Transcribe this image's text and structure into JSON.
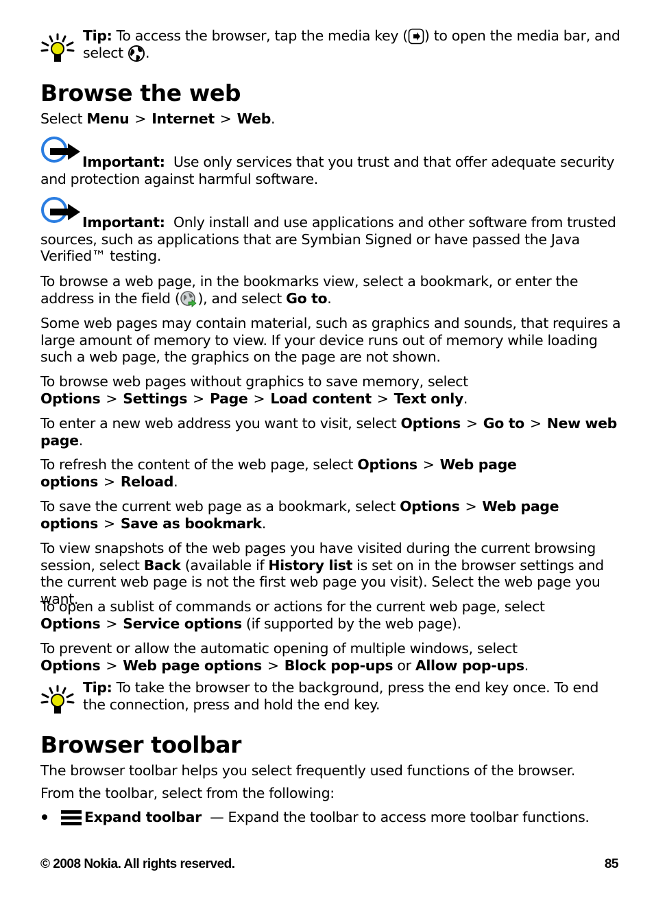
{
  "tip1": {
    "label": "Tip:",
    "text_a": " To access the browser, tap the media key (",
    "text_b": ") to open the media bar, and select ",
    "text_c": ".",
    "icons": [
      "lightbulb-tip-icon",
      "media-key-icon",
      "globe-web-icon"
    ]
  },
  "section1": {
    "title": "Browse the web",
    "path_intro": "Select ",
    "path": [
      "Menu",
      "Internet",
      "Web"
    ],
    "path_end": "."
  },
  "important1": {
    "label": "Important:",
    "text": "Use only services that you trust and that offer adequate security and protection against harmful software."
  },
  "important2": {
    "label": "Important:",
    "text": "Only install and use applications and other software from trusted sources, such as applications that are Symbian Signed or have passed the Java Verified™ testing."
  },
  "paragraphs": {
    "p1_a": "To browse a web page, in the bookmarks view, select a bookmark, or enter the address in the field (",
    "p1_b": "), and select ",
    "p1_bold": "Go to",
    "p1_c": ".",
    "p2": "Some web pages may contain material, such as graphics and sounds, that requires a large amount of memory to view. If your device runs out of memory while loading such a web page, the graphics on the page are not shown.",
    "p3_a": "To browse web pages without graphics to save memory, select ",
    "p3_path": [
      "Options",
      "Settings",
      "Page",
      "Load content",
      "Text only"
    ],
    "p4_a": "To enter a new web address you want to visit, select ",
    "p4_path": [
      "Options",
      "Go to",
      "New web page"
    ],
    "p5_a": "To refresh the content of the web page, select ",
    "p5_path": [
      "Options",
      "Web page options",
      "Reload"
    ],
    "p6_a": "To save the current web page as a bookmark, select ",
    "p6_path": [
      "Options",
      "Web page options",
      "Save as bookmark"
    ],
    "p7_a": "To view snapshots of the web pages you have visited during the current browsing session, select ",
    "p7_b1": "Back",
    "p7_b": " (available if ",
    "p7_b2": "History list",
    "p7_c": " is set on in the browser settings and the current web page is not the first web page you visit). Select the web page you want.",
    "p8_a": "To open a sublist of commands or actions for the current web page, select ",
    "p8_path": [
      "Options",
      "Service options"
    ],
    "p8_c": " (if supported by the web page).",
    "p9_a": "To prevent or allow the automatic opening of multiple windows, select ",
    "p9_path": [
      "Options",
      "Web page options",
      "Block pop-ups"
    ],
    "p9_or": " or ",
    "p9_b": "Allow pop-ups",
    "sep": ">",
    "period": "."
  },
  "tip2": {
    "label": "Tip:",
    "text": " To take the browser to the background, press the end key once. To end the connection, press and hold the end key."
  },
  "section2": {
    "title": "Browser toolbar",
    "p1": "The browser toolbar helps you select frequently used functions of the browser.",
    "p2": "From the toolbar, select from the following:",
    "items": [
      {
        "icon": "expand-toolbar-icon",
        "label": "Expand toolbar",
        "desc": " — Expand the toolbar to access more toolbar functions."
      }
    ]
  },
  "footer": {
    "copyright": "© 2008 Nokia. All rights reserved.",
    "page_number": "85"
  }
}
